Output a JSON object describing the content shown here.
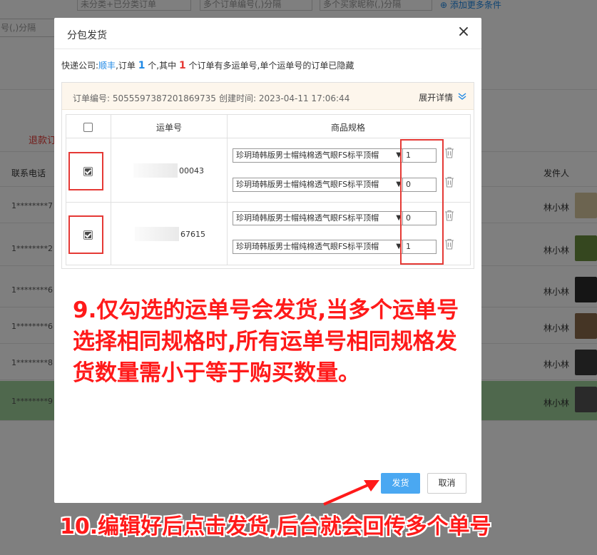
{
  "background": {
    "filters": [
      "未分类+已分类订单",
      "多个订单编号(,)分隔",
      "多个买家昵称(,)分隔"
    ],
    "add_more": "添加更多条件",
    "input2_placeholder": "号(,)分隔",
    "tab_refund": "退款订",
    "col_phone": "联系电话",
    "col_sender": "发件人",
    "rows": [
      {
        "phone": "1********7",
        "sender": "林小林"
      },
      {
        "phone": "1********2",
        "sender": "林小林"
      },
      {
        "phone": "1********6",
        "sender": "林小林"
      },
      {
        "phone": "1********6",
        "sender": "林小林"
      },
      {
        "phone": "1********8",
        "sender": "林小林"
      },
      {
        "phone": "1********9",
        "sender": "林小林"
      }
    ]
  },
  "modal": {
    "title": "分包发货",
    "close": "×",
    "info": {
      "prefix": "快递公司:",
      "courier": "顺丰",
      "order_text": ",订单",
      "order_count": "1",
      "unit1": "个,其中",
      "multi_count": "1",
      "suffix": "个订单有多运单号,单个运单号的订单已隐藏"
    },
    "order": {
      "order_no_label": "订单编号:",
      "order_no": "5055597387201869735",
      "time_label": "创建时间:",
      "time": "2023-04-11 17:06:44",
      "expand": "展开详情"
    },
    "table": {
      "col_waybill": "运单号",
      "col_spec": "商品规格",
      "rows": [
        {
          "waybill_suffix": "00043",
          "checked": true,
          "specs": [
            {
              "name": "珍玥琦韩版男士帽纯棉透气眼FS标平顶帽",
              "qty": "1"
            },
            {
              "name": "珍玥琦韩版男士帽纯棉透气眼FS标平顶帽",
              "qty": "0"
            }
          ]
        },
        {
          "waybill_suffix": "67615",
          "checked": true,
          "specs": [
            {
              "name": "珍玥琦韩版男士帽纯棉透气眼FS标平顶帽",
              "qty": "0"
            },
            {
              "name": "珍玥琦韩版男士帽纯棉透气眼FS标平顶帽",
              "qty": "1"
            }
          ]
        }
      ]
    },
    "annotation_9": "9.仅勾选的运单号会发货,当多个运单号选择相同规格时,所有运单号相同规格发货数量需小于等于购买数量。",
    "btn_ship": "发货",
    "btn_cancel": "取消"
  },
  "annotation_10": "10.编辑好后点击发货,后台就会回传多个单号",
  "colors": {
    "accent": "#1e88e5",
    "annotation": "#ff1a1a",
    "primary_button": "#4aa8f2",
    "order_header_bg": "#fdf6ec",
    "selected_row": "#9ed09a"
  }
}
